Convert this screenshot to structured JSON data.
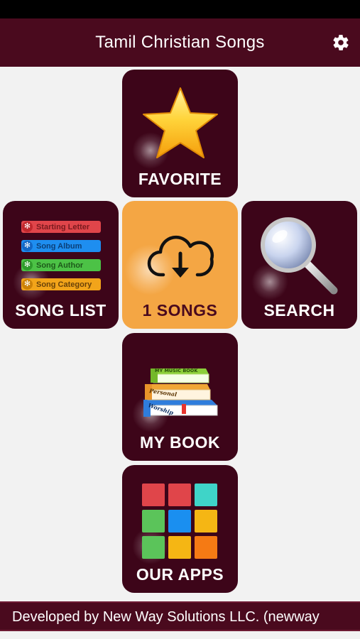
{
  "header": {
    "title": "Tamil Christian Songs",
    "settings_icon": "gear-icon"
  },
  "tiles": {
    "favorite": {
      "label": "FAVORITE",
      "icon": "star-icon"
    },
    "song_list": {
      "label": "SONG LIST",
      "items": [
        "Starting Letter",
        "Song Album",
        "Song Author",
        "Song Category"
      ],
      "colors": [
        "#e0454a",
        "#1e8ef0",
        "#4cc246",
        "#f2a41a"
      ]
    },
    "songs": {
      "label": "1 SONGS",
      "icon": "cloud-download-icon"
    },
    "search": {
      "label": "SEARCH",
      "icon": "magnifier-icon"
    },
    "my_book": {
      "label": "MY BOOK",
      "icon": "books-icon",
      "book_titles": [
        "MY MUSIC BOOK",
        "Personal",
        "Worship"
      ]
    },
    "our_apps": {
      "label": "OUR APPS",
      "icon": "apps-grid-icon",
      "grid_colors": [
        "#e0454a",
        "#e0454a",
        "#3fd4c8",
        "#5bc45a",
        "#1a8ff0",
        "#f5b614",
        "#5bc45a",
        "#f5b614",
        "#f57a14"
      ]
    }
  },
  "footer": {
    "text": "Developed by New Way Solutions LLC. (newway"
  },
  "colors": {
    "primary": "#4a0a1e",
    "tile": "#3d0519",
    "accent": "#f4a644",
    "background": "#f2f2f2"
  }
}
